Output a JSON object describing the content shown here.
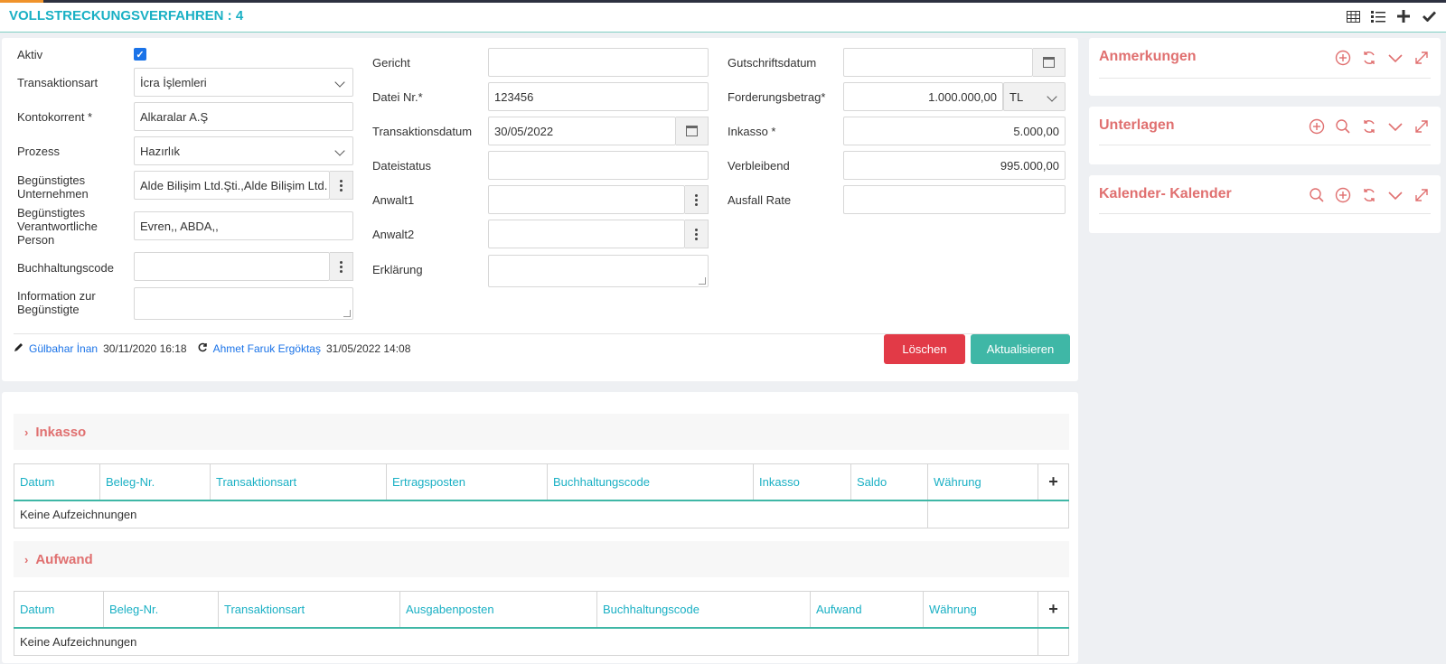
{
  "header": {
    "title": "VOLLSTRECKUNGSVERFAHREN : 4",
    "icons": [
      "table-icon",
      "list-icon",
      "plus-icon",
      "check-icon"
    ]
  },
  "form": {
    "col1": {
      "aktiv": {
        "label": "Aktiv",
        "checked": true
      },
      "transaktionsart": {
        "label": "Transaktionsart",
        "value": "İcra İşlemleri"
      },
      "kontokorrent": {
        "label": "Kontokorrent *",
        "value": "Alkaralar A.Ş"
      },
      "prozess": {
        "label": "Prozess",
        "value": "Hazırlık"
      },
      "beg_unternehmen": {
        "label_line1": "Begünstigtes",
        "label_line2": "Unternehmen",
        "value": "Alde Bilişim Ltd.Şti.,Alde Bilişim Ltd."
      },
      "beg_person": {
        "label_line1": "Begünstigtes",
        "label_line2": "Verantwortliche",
        "label_line3": "Person",
        "value": "Evren,, ABDA,,"
      },
      "buchhaltungscode": {
        "label": "Buchhaltungscode",
        "value": ""
      },
      "information": {
        "label_line1": "Information zur",
        "label_line2": "Begünstigte",
        "value": ""
      }
    },
    "col2": {
      "gericht": {
        "label": "Gericht",
        "value": ""
      },
      "datei_nr": {
        "label": "Datei Nr.*",
        "value": "123456"
      },
      "transaktionsdatum": {
        "label": "Transaktionsdatum",
        "value": "30/05/2022"
      },
      "dateistatus": {
        "label": "Dateistatus",
        "value": ""
      },
      "anwalt1": {
        "label": "Anwalt1",
        "value": ""
      },
      "anwalt2": {
        "label": "Anwalt2",
        "value": ""
      },
      "erklaerung": {
        "label": "Erklärung",
        "value": ""
      }
    },
    "col3": {
      "gutschriftsdatum": {
        "label": "Gutschriftsdatum",
        "value": ""
      },
      "forderungsbetrag": {
        "label": "Forderungsbetrag*",
        "value": "1.000.000,00",
        "currency": "TL"
      },
      "inkasso": {
        "label": "Inkasso *",
        "value": "5.000,00"
      },
      "verbleibend": {
        "label": "Verbleibend",
        "value": "995.000,00"
      },
      "ausfall_rate": {
        "label": "Ausfall Rate",
        "value": ""
      }
    },
    "audit": {
      "created_by": "Gülbahar İnan",
      "created_at": "30/11/2020 16:18",
      "updated_by": "Ahmet Faruk Ergöktaş",
      "updated_at": "31/05/2022 14:08"
    },
    "buttons": {
      "delete": "Löschen",
      "update": "Aktualisieren"
    }
  },
  "side_panels": [
    {
      "title": "Anmerkungen",
      "icons": [
        "add-icon",
        "refresh-icon",
        "collapse-icon",
        "expand-icon"
      ]
    },
    {
      "title": "Unterlagen",
      "icons": [
        "add-icon",
        "search-icon",
        "refresh-icon",
        "collapse-icon",
        "expand-icon"
      ]
    },
    {
      "title": "Kalender- Kalender",
      "icons": [
        "search-icon",
        "add-icon",
        "refresh-icon",
        "collapse-icon",
        "expand-icon"
      ]
    }
  ],
  "inkasso_section": {
    "title": "Inkasso",
    "columns": [
      "Datum",
      "Beleg-Nr.",
      "Transaktionsart",
      "Ertragsposten",
      "Buchhaltungscode",
      "Inkasso",
      "Saldo",
      "Währung"
    ],
    "empty_text": "Keine Aufzeichnungen"
  },
  "aufwand_section": {
    "title": "Aufwand",
    "columns": [
      "Datum",
      "Beleg-Nr.",
      "Transaktionsart",
      "Ausgabenposten",
      "Buchhaltungscode",
      "Aufwand",
      "Währung"
    ],
    "empty_text": "Keine Aufzeichnungen"
  },
  "colors": {
    "accent_teal": "#1ab0c4",
    "button_teal": "#3fb7a6",
    "danger": "#e23a47",
    "section_title": "#e07070",
    "link": "#1a73e8"
  }
}
